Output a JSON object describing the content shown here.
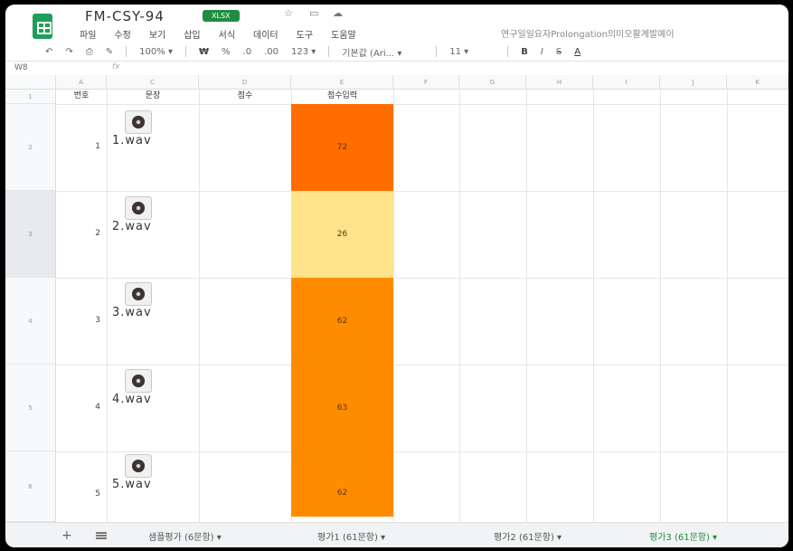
{
  "header": {
    "doc_title": "FM-CSY-94",
    "badge": "XLSX",
    "icons": [
      "star-icon",
      "move-icon",
      "cloud-icon"
    ],
    "menu": [
      "파일",
      "수정",
      "보기",
      "삽입",
      "서식",
      "데이터",
      "도구",
      "도움말"
    ],
    "info_text": "연구일일요자Prolongation의미오활계발예이"
  },
  "toolbar": {
    "zoom": "100%",
    "currency": "₩",
    "percent": "%",
    "decimal_dec": ".0",
    "decimal_inc": ".00",
    "number_format": "123",
    "font": "기본값 (Ari...",
    "font_size": "11",
    "bold": "B",
    "italic": "I",
    "strike": "S",
    "text_color": "A"
  },
  "formula_bar": {
    "cell_ref": "W8",
    "fx": "fx"
  },
  "grid": {
    "columns": [
      "A",
      "C",
      "D",
      "E",
      "F",
      "G",
      "H",
      "I",
      "J",
      "K"
    ],
    "row_numbers": [
      "1",
      "2",
      "3",
      "4",
      "5",
      "6"
    ],
    "headers": {
      "number": "번호",
      "sentence": "문장",
      "score": "점수",
      "score_input": "점수입력"
    },
    "rows": [
      {
        "num": "1",
        "file": "1.wav",
        "score": "72",
        "color": "#ff6d00"
      },
      {
        "num": "2",
        "file": "2.wav",
        "score": "26",
        "color": "#ffe38a"
      },
      {
        "num": "3",
        "file": "3.wav",
        "score": "62",
        "color": "#ff8c00"
      },
      {
        "num": "4",
        "file": "4.wav",
        "score": "63",
        "color": "#ff8c00"
      },
      {
        "num": "5",
        "file": "5.wav",
        "score": "62",
        "color": "#ff8c00"
      }
    ]
  },
  "sheets": [
    {
      "label": "샘플평가 (6문항)",
      "active": false
    },
    {
      "label": "평가1 (61문항)",
      "active": false
    },
    {
      "label": "평가2 (61문항)",
      "active": false
    },
    {
      "label": "평가3 (61문항)",
      "active": true
    }
  ],
  "colors": {
    "accent": "#1e8e3e",
    "selected_row": "#e8eaed"
  }
}
